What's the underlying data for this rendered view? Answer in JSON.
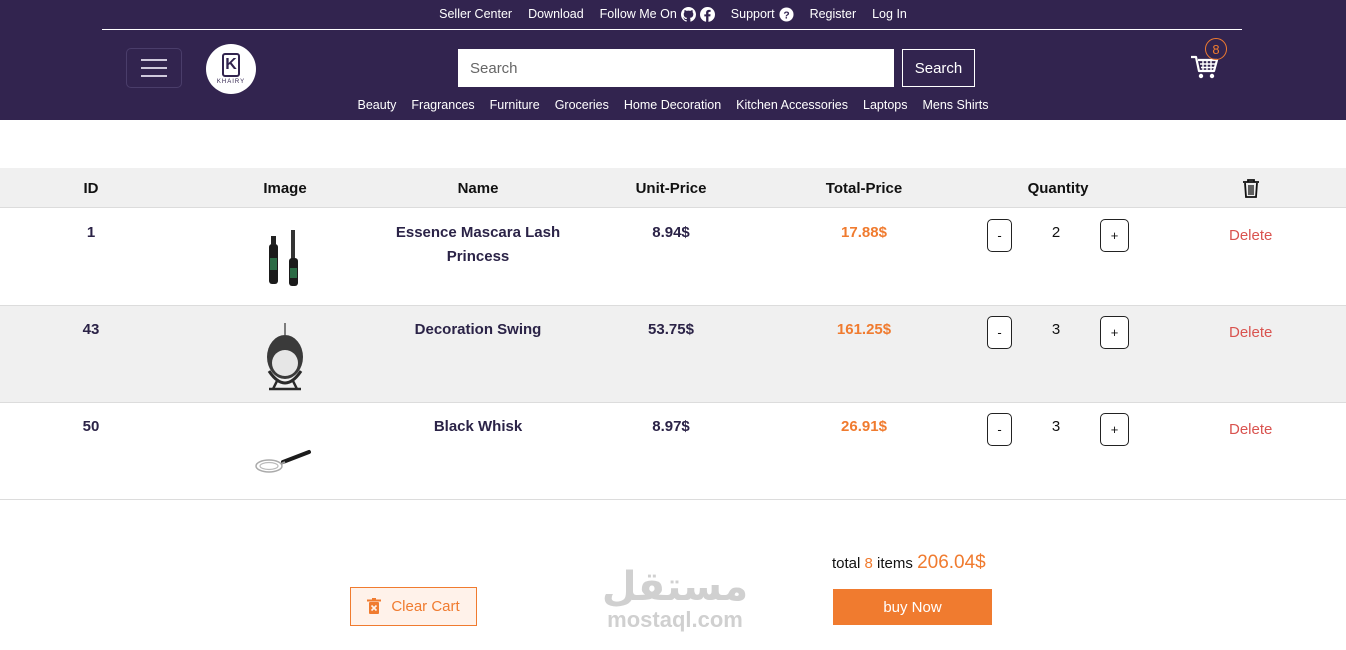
{
  "topnav": {
    "seller_center": "Seller Center",
    "download": "Download",
    "follow_me_on": "Follow Me On",
    "support": "Support",
    "register": "Register",
    "log_in": "Log In"
  },
  "header": {
    "logo_brand": "KHAIRY",
    "logo_letter": "K",
    "search_placeholder": "Search",
    "search_button": "Search",
    "cart_count": "8"
  },
  "categories": [
    "Beauty",
    "Fragrances",
    "Furniture",
    "Groceries",
    "Home Decoration",
    "Kitchen Accessories",
    "Laptops",
    "Mens Shirts"
  ],
  "table": {
    "headers": {
      "id": "ID",
      "image": "Image",
      "name": "Name",
      "unit_price": "Unit-Price",
      "total_price": "Total-Price",
      "quantity": "Quantity"
    },
    "rows": [
      {
        "id": "1",
        "name": "Essence Mascara Lash Princess",
        "unit_price": "8.94$",
        "total_price": "17.88$",
        "quantity": "2",
        "minus": "-",
        "plus": "+",
        "delete": "Delete",
        "image_icon": "mascara-image"
      },
      {
        "id": "43",
        "name": "Decoration Swing",
        "unit_price": "53.75$",
        "total_price": "161.25$",
        "quantity": "3",
        "minus": "-",
        "plus": "+",
        "delete": "Delete",
        "image_icon": "swing-chair-image"
      },
      {
        "id": "50",
        "name": "Black Whisk",
        "unit_price": "8.97$",
        "total_price": "26.91$",
        "quantity": "3",
        "minus": "-",
        "plus": "+",
        "delete": "Delete",
        "image_icon": "whisk-image"
      }
    ]
  },
  "footer": {
    "clear_cart": "Clear Cart",
    "total_label": "total",
    "total_items": "8",
    "items_label": "items",
    "total_amount": "206.04$",
    "buy_now": "buy Now"
  },
  "watermark": {
    "arabic": "مستقل",
    "latin": "mostaql.com"
  },
  "colors": {
    "header_bg": "#32244f",
    "accent": "#f07b2f",
    "delete": "#d9534f",
    "row_alt": "#f0f0f0"
  }
}
